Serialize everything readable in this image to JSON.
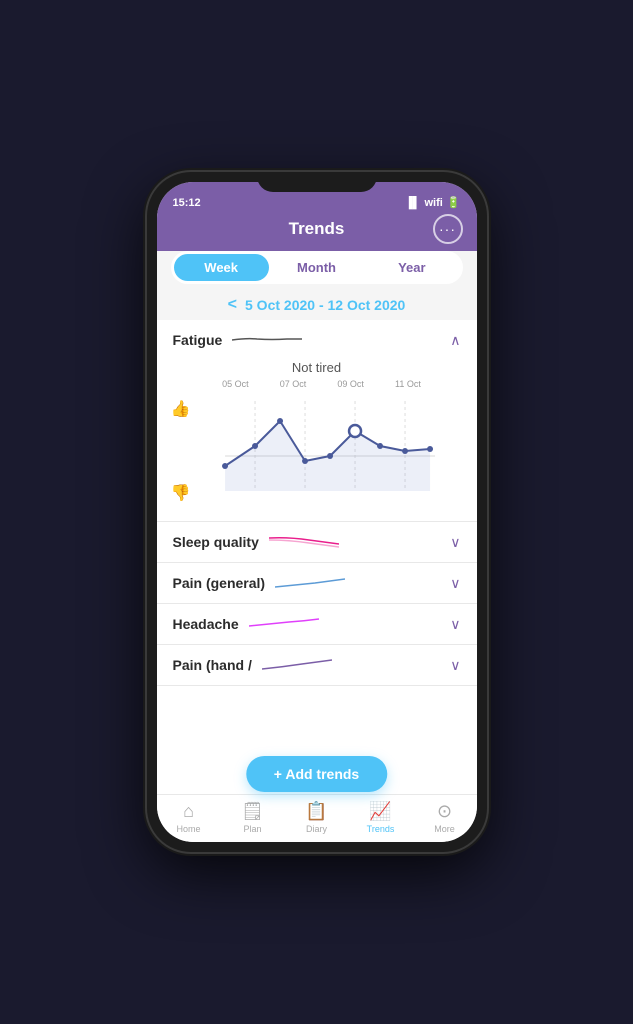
{
  "status_bar": {
    "time": "15:12"
  },
  "header": {
    "title": "Trends",
    "more_label": "···"
  },
  "tabs": {
    "items": [
      {
        "label": "Week",
        "active": true
      },
      {
        "label": "Month",
        "active": false
      },
      {
        "label": "Year",
        "active": false
      }
    ]
  },
  "date_nav": {
    "arrow": "<",
    "range": "5 Oct 2020 - 12 Oct 2020"
  },
  "fatigue": {
    "title": "Fatigue",
    "chart_top_label": "Not tired",
    "x_labels": [
      "05 Oct",
      "07 Oct",
      "09 Oct",
      "11 Oct"
    ],
    "expanded": true
  },
  "sleep_quality": {
    "title": "Sleep quality",
    "expanded": false
  },
  "pain_general": {
    "title": "Pain (general)",
    "expanded": false
  },
  "headache": {
    "title": "Headache",
    "expanded": false
  },
  "pain_hand": {
    "title": "Pain (hand /",
    "expanded": false
  },
  "add_trends": {
    "label": "+ Add trends"
  },
  "bottom_nav": {
    "items": [
      {
        "label": "Home",
        "icon": "🏠",
        "active": false
      },
      {
        "label": "Plan",
        "icon": "📋",
        "active": false
      },
      {
        "label": "Diary",
        "icon": "📝",
        "active": false
      },
      {
        "label": "Trends",
        "icon": "📈",
        "active": true
      },
      {
        "label": "More",
        "icon": "😶",
        "active": false
      }
    ]
  }
}
